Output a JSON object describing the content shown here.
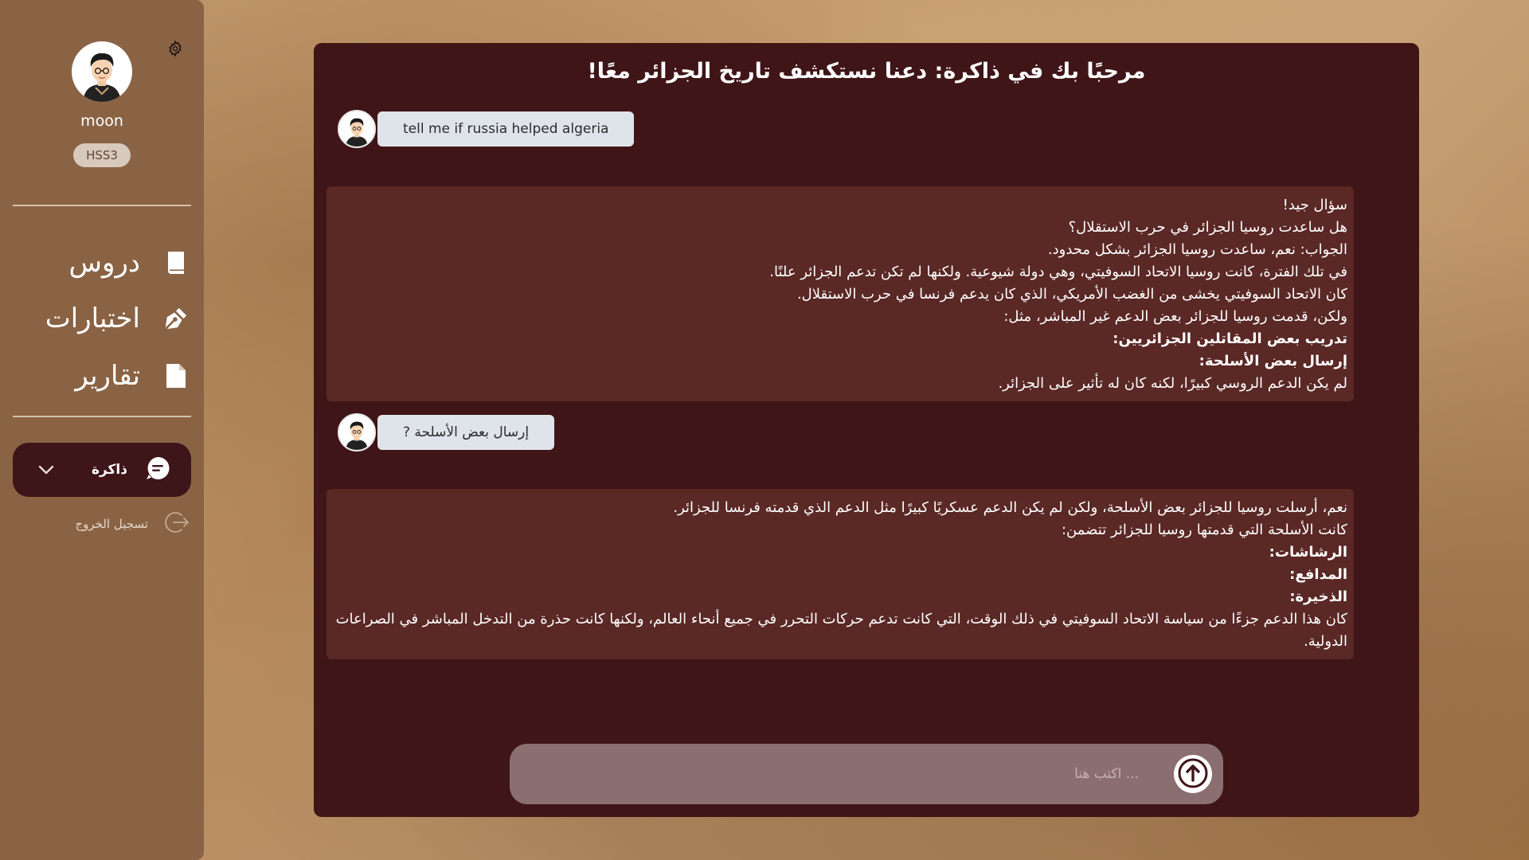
{
  "sidebar": {
    "username": "moon",
    "badge": "HSS3",
    "nav": [
      {
        "label": "دروس",
        "icon": "book-icon"
      },
      {
        "label": "اختبارات",
        "icon": "pen-nib-icon"
      },
      {
        "label": "تقارير",
        "icon": "file-icon"
      }
    ],
    "chat_label": "ذاكرة",
    "logout_label": "تسجيل الخروج"
  },
  "panel": {
    "title": "مرحبًا بك في ذاكرة: دعنا نستكشف تاريخ الجزائر معًا!",
    "user_messages": [
      {
        "text": "tell me if russia helped algeria"
      },
      {
        "text": "إرسال بعض الأسلحة ?"
      }
    ],
    "bot_messages": [
      {
        "lines": [
          {
            "text": "سؤال جيد!",
            "bold": false
          },
          {
            "text": "هل ساعدت روسيا الجزائر في حرب الاستقلال؟",
            "bold": false
          },
          {
            "text": "الجواب: نعم، ساعدت روسيا الجزائر بشكل محدود.",
            "bold": false
          },
          {
            "text": "في تلك الفترة، كانت روسيا الاتحاد السوفيتي، وهي دولة شيوعية. ولكنها لم تكن تدعم الجزائر علنًا.",
            "bold": false
          },
          {
            "text": "كان الاتحاد السوفيتي يخشى من الغضب الأمريكي، الذي كان يدعم فرنسا في حرب الاستقلال.",
            "bold": false
          },
          {
            "text": "ولكن، قدمت روسيا للجزائر بعض الدعم غير المباشر، مثل:",
            "bold": false
          },
          {
            "text": "تدريب بعض المقاتلين الجزائريين:",
            "bold": true
          },
          {
            "text": "إرسال بعض الأسلحة:",
            "bold": true
          },
          {
            "text": "لم يكن الدعم الروسي كبيرًا، لكنه كان له تأثير على الجزائر.",
            "bold": false
          }
        ]
      },
      {
        "lines": [
          {
            "text": "نعم، أرسلت روسيا للجزائر بعض الأسلحة، ولكن لم يكن الدعم عسكريًا كبيرًا مثل الدعم الذي قدمته فرنسا للجزائر.",
            "bold": false
          },
          {
            "text": "كانت الأسلحة التي قدمتها روسيا للجزائر تتضمن:",
            "bold": false
          },
          {
            "text": "الرشاشات:",
            "bold": true
          },
          {
            "text": "المدافع:",
            "bold": true
          },
          {
            "text": "الذخيرة:",
            "bold": true
          },
          {
            "text": "كان هذا الدعم جزءًا من سياسة الاتحاد السوفيتي في ذلك الوقت، التي كانت تدعم حركات التحرر في جميع أنحاء العالم، ولكنها كانت حذرة من التدخل المباشر في الصراعات الدولية.",
            "bold": false,
            "wrap": true
          }
        ]
      }
    ],
    "composer_placeholder": "... اكتب هنا"
  },
  "colors": {
    "sidebar": "#8a6344",
    "panel": "#401518",
    "bot_bubble": "#5a2825",
    "user_bubble": "#dfe4ea",
    "composer": "#8b6f70",
    "chat_pill": "#3e1518"
  }
}
